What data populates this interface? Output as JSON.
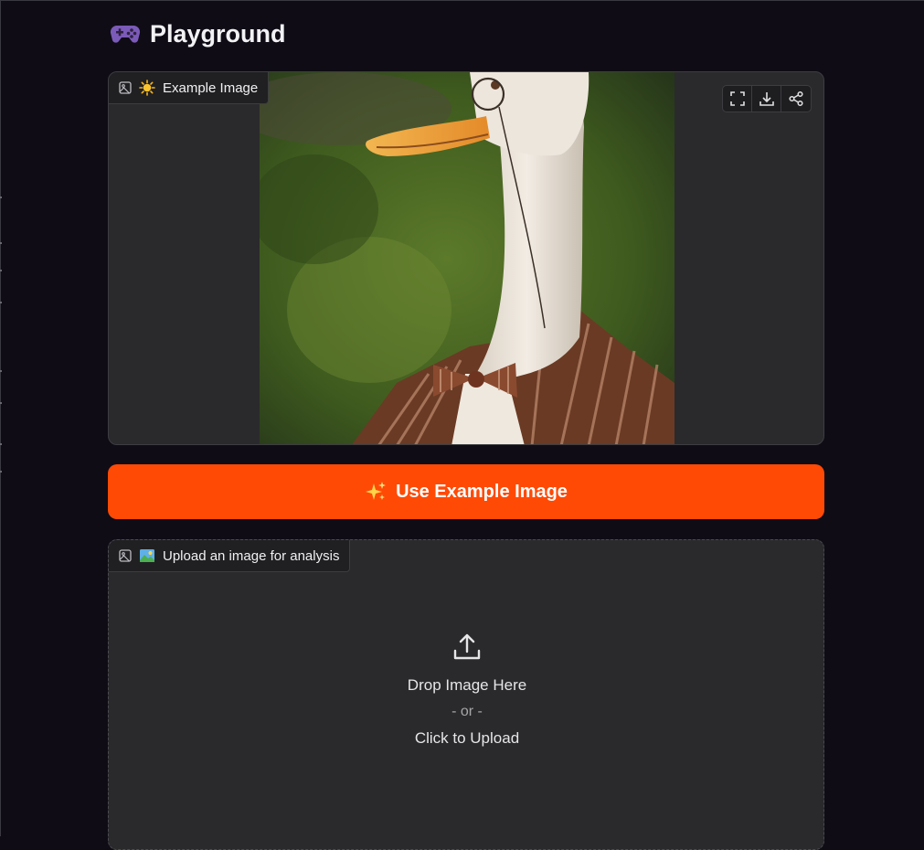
{
  "header": {
    "title": "Playground",
    "icon": "gamepad-icon"
  },
  "example_panel": {
    "label": "Example Image",
    "label_emoji": "sun-icon",
    "image_subject": "painting of a goose with a monocle wearing a striped suit jacket and bow tie",
    "toolbar": [
      "fullscreen-icon",
      "download-icon",
      "share-icon"
    ]
  },
  "use_example_button": {
    "label": "Use Example Image",
    "emoji": "sparkles-icon",
    "color": "#ff4a06"
  },
  "upload_panel": {
    "label": "Upload an image for analysis",
    "label_emoji": "picture-icon",
    "drop_text": "Drop Image Here",
    "or_text": "- or -",
    "click_text": "Click to Upload"
  },
  "colors": {
    "background": "#0f0c16",
    "panel": "#2a2a2c",
    "accent": "#ff4a06"
  }
}
